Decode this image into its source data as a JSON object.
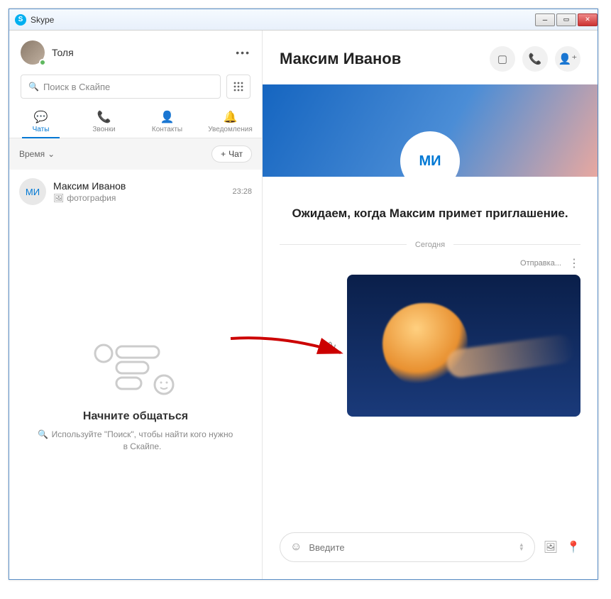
{
  "window": {
    "title": "Skype"
  },
  "user": {
    "name": "Толя"
  },
  "search": {
    "placeholder": "Поиск в Скайпе"
  },
  "tabs": {
    "chats": "Чаты",
    "calls": "Звонки",
    "contacts": "Контакты",
    "notifications": "Уведомления"
  },
  "filter": {
    "label": "Время",
    "newChat": "Чат"
  },
  "conversation": {
    "initials": "МИ",
    "name": "Максим Иванов",
    "preview": "фотография",
    "time": "23:28"
  },
  "emptyState": {
    "title": "Начните общаться",
    "subtitle": "Используйте \"Поиск\", чтобы найти кого нужно в Скайпе."
  },
  "chat": {
    "title": "Максим Иванов",
    "avatarInitials": "МИ",
    "pending": "Ожидаем, когда Максим примет приглашение.",
    "dateLabel": "Сегодня",
    "sending": "Отправка..."
  },
  "composer": {
    "placeholder": "Введите"
  }
}
